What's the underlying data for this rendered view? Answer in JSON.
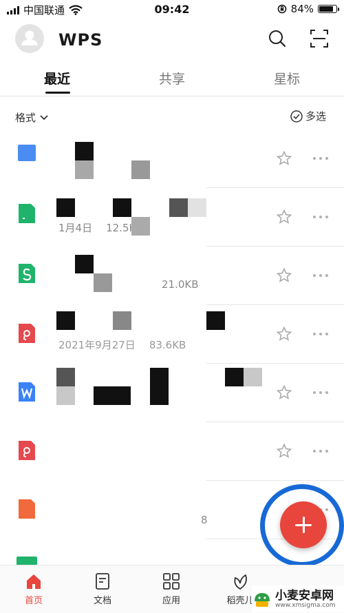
{
  "status_bar": {
    "carrier": "中国联通",
    "time": "09:42",
    "battery": "84%"
  },
  "header": {
    "logo": "WPS",
    "icons": [
      "search-icon",
      "scan-icon"
    ]
  },
  "tabs": [
    {
      "label": "最近",
      "active": true
    },
    {
      "label": "共享",
      "active": false
    },
    {
      "label": "星标",
      "active": false
    }
  ],
  "list_header": {
    "format_filter": "格式",
    "multiselect": "多选"
  },
  "files": [
    {
      "type": "doc",
      "color": "#4a8cf1",
      "name": "",
      "date": "",
      "size": "",
      "starred": false
    },
    {
      "type": "sheet",
      "color": "#1fb36b",
      "name": "",
      "date": "1月4日",
      "size": "12.5KB",
      "starred": false
    },
    {
      "type": "slides",
      "color": "#1fb36b",
      "name": "",
      "date": "",
      "size": "21.0KB",
      "starred": false
    },
    {
      "type": "pdf",
      "color": "#e5484d",
      "name": "",
      "date": "2021年9月27日",
      "size": "83.6KB",
      "starred": false
    },
    {
      "type": "word",
      "color": "#3b82f6",
      "name": "",
      "date": "",
      "size": "",
      "starred": false
    },
    {
      "type": "pdf",
      "color": "#e5484d",
      "name": "",
      "date": "",
      "size": "",
      "starred": false
    },
    {
      "type": "ppt",
      "color": "#f06a3b",
      "name": "",
      "date": "",
      "size": "8",
      "starred": false
    }
  ],
  "fab": {
    "icon": "plus-icon",
    "color": "#e8453c"
  },
  "bottom_nav": [
    {
      "label": "首页",
      "icon": "home-icon",
      "active": true
    },
    {
      "label": "文档",
      "icon": "document-icon",
      "active": false
    },
    {
      "label": "应用",
      "icon": "apps-icon",
      "active": false
    },
    {
      "label": "稻壳儿",
      "icon": "leaf-icon",
      "active": false
    }
  ],
  "watermark": {
    "text": "小麦安卓网",
    "url": "www.xmsigma.com"
  }
}
